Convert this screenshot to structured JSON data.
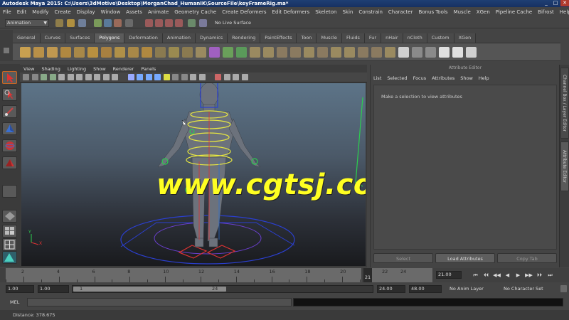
{
  "window": {
    "title": "Autodesk Maya 2015: C:\\Users\\3dMotive\\Desktop\\MorganChad_HumanIK\\SourceFile\\keyFrameRig.ma*",
    "minimize": "_",
    "maximize": "□",
    "close": "✕"
  },
  "menubar": [
    "File",
    "Edit",
    "Modify",
    "Create",
    "Display",
    "Window",
    "Assets",
    "Animate",
    "Geometry Cache",
    "Create Deformers",
    "Edit Deformers",
    "Skeleton",
    "Skin",
    "Constrain",
    "Character",
    "Bonus Tools",
    "Muscle",
    "XGen",
    "Pipeline Cache",
    "Bifrost",
    "Help"
  ],
  "status_line": {
    "mode": "Animation",
    "live_surface": "No Live Surface"
  },
  "shelf_tabs": [
    "General",
    "Curves",
    "Surfaces",
    "Polygons",
    "Deformation",
    "Animation",
    "Dynamics",
    "Rendering",
    "PaintEffects",
    "Toon",
    "Muscle",
    "Fluids",
    "Fur",
    "nHair",
    "nCloth",
    "Custom",
    "XGen"
  ],
  "active_shelf_tab": "Polygons",
  "viewport": {
    "menu": [
      "View",
      "Shading",
      "Lighting",
      "Show",
      "Renderer",
      "Panels"
    ],
    "watermark": "www.cgtsj.com",
    "axis_y": "Y",
    "axis_x": "X"
  },
  "attribute_editor": {
    "title": "Attribute Editor",
    "menu": [
      "List",
      "Selected",
      "Focus",
      "Attributes",
      "Show",
      "Help"
    ],
    "message": "Make a selection to view attributes",
    "buttons": {
      "select": "Select",
      "load": "Load Attributes",
      "copy": "Copy Tab"
    }
  },
  "side_tabs": [
    "Channel Box / Layer Editor",
    "Attribute Editor"
  ],
  "time_slider": {
    "ticks": [
      "2",
      "4",
      "6",
      "8",
      "10",
      "12",
      "14",
      "16",
      "18",
      "20"
    ],
    "after_ticks": [
      "22",
      "24"
    ],
    "current_frame": "21",
    "current_frame_field": "21.00",
    "playback": [
      "⏮",
      "⏴⏴",
      "◀◀",
      "◀",
      "▶",
      "▶▶",
      "⏵⏵",
      "⏭"
    ]
  },
  "range_slider": {
    "start": "1.00",
    "start_inner": "1.00",
    "range_start_label": "1",
    "range_end_label": "24",
    "end_inner": "24.00",
    "end": "48.00",
    "anim_layer": "No Anim Layer",
    "character_set": "No Character Set"
  },
  "command_line": {
    "label": "MEL"
  },
  "help_line": {
    "text": "Distance:   378.675"
  }
}
